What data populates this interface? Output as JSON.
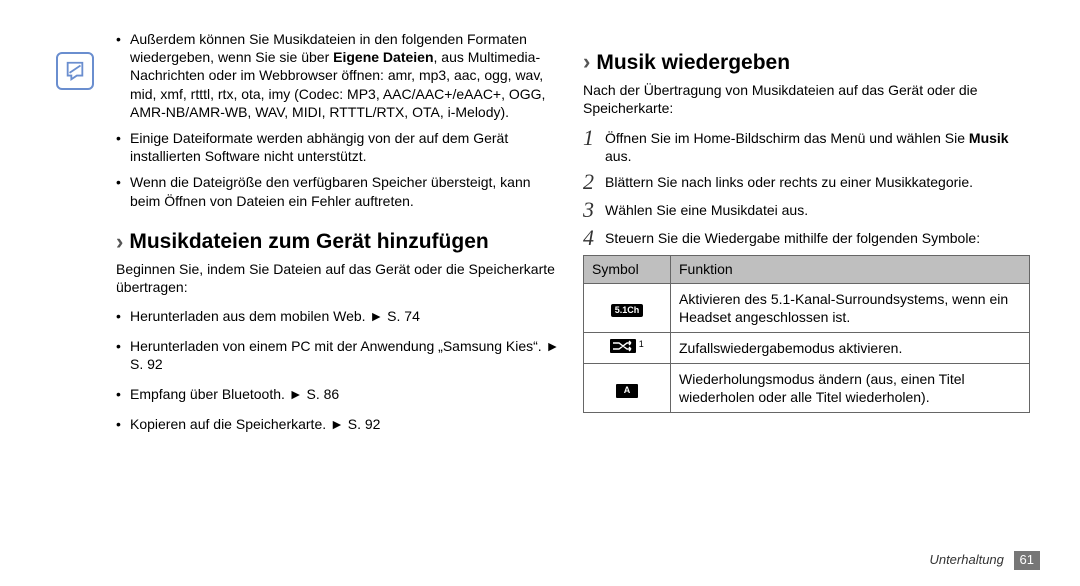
{
  "note": {
    "item1_a": "Außerdem können Sie Musikdateien in den folgenden Formaten wiedergeben, wenn Sie sie über ",
    "item1_b1": "Eigene Dateien",
    "item1_c": ", aus Multimedia-Nachrichten oder im Webbrowser öffnen: amr, mp3, aac, ogg, wav, mid, xmf, rtttl, rtx, ota, imy (Codec: MP3, AAC/AAC+/eAAC+, OGG, AMR-NB/AMR-WB, WAV, MIDI, RTTTL/RTX, OTA, i-Melody).",
    "item2": "Einige Dateiformate werden abhängig von der auf dem Gerät installierten Software nicht unterstützt.",
    "item3": "Wenn die Dateigröße den verfügbaren Speicher übersteigt, kann beim Öffnen von Dateien ein Fehler auftreten."
  },
  "sec1": {
    "title": "Musikdateien zum Gerät hinzufügen",
    "intro": "Beginnen Sie, indem Sie Dateien auf das Gerät oder die Speicherkarte übertragen:",
    "dl1": "Herunterladen aus dem mobilen Web. ► S. 74",
    "dl2": "Herunterladen von einem PC mit der Anwendung „Samsung Kies“. ► S. 92",
    "dl3": "Empfang über Bluetooth. ► S. 86",
    "dl4": "Kopieren auf die Speicherkarte. ► S. 92"
  },
  "sec2": {
    "title": "Musik wiedergeben",
    "intro": "Nach der Übertragung von Musikdateien auf das Gerät oder die Speicherkarte:",
    "step1_a": "Öffnen Sie im Home-Bildschirm das Menü und wählen Sie ",
    "step1_b": "Musik",
    "step1_c": " aus.",
    "step2": "Blättern Sie nach links oder rechts zu einer Musikkategorie.",
    "step3": "Wählen Sie eine Musikdatei aus.",
    "step4": "Steuern Sie die Wiedergabe mithilfe der folgenden Symbole:"
  },
  "table": {
    "h1": "Symbol",
    "h2": "Funktion",
    "r1_icon": "5.1Ch",
    "r1_txt": "Aktivieren des 5.1-Kanal-Surroundsystems, wenn ein Headset angeschlossen ist.",
    "r2_txt": "Zufallswiedergabemodus aktivieren.",
    "r3_icon": "A",
    "r3_txt": "Wiederholungsmodus ändern (aus, einen Titel wiederholen oder alle Titel wiederholen)."
  },
  "footer": {
    "section": "Unterhaltung",
    "page": "61"
  }
}
